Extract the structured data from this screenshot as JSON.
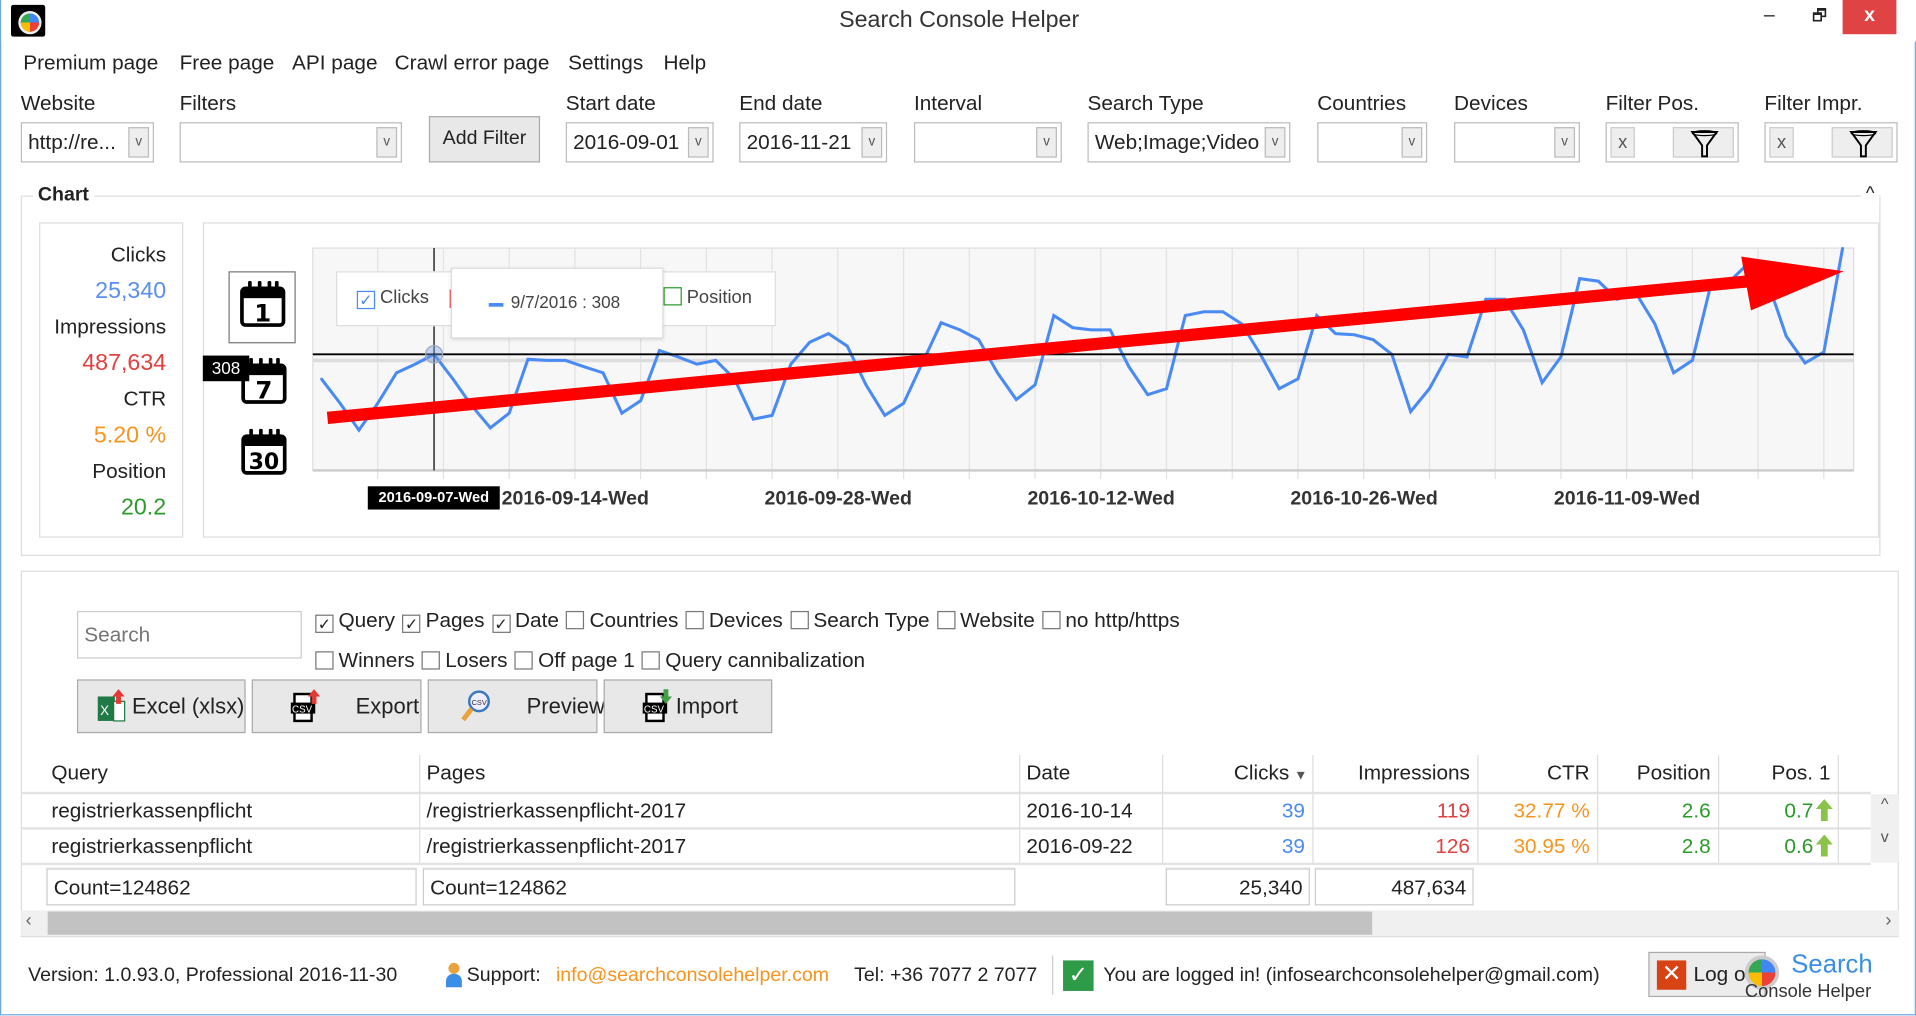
{
  "window": {
    "title": "Search Console Helper",
    "minimize": "–",
    "restore": "🗗",
    "close": "x"
  },
  "menu": [
    "Premium page",
    "Free page",
    "API page",
    "Crawl error page",
    "Settings",
    "Help"
  ],
  "toolbar": {
    "website": {
      "label": "Website",
      "value": "http://re..."
    },
    "filters": {
      "label": "Filters",
      "value": ""
    },
    "add_filter": "Add Filter",
    "start_date": {
      "label": "Start date",
      "value": "2016-09-01"
    },
    "end_date": {
      "label": "End date",
      "value": "2016-11-21"
    },
    "interval": {
      "label": "Interval",
      "value": ""
    },
    "search_type": {
      "label": "Search Type",
      "value": "Web;Image;Video"
    },
    "countries": {
      "label": "Countries",
      "value": ""
    },
    "devices": {
      "label": "Devices",
      "value": ""
    },
    "filter_pos": {
      "label": "Filter Pos.",
      "clear": "x"
    },
    "filter_impr": {
      "label": "Filter Impr.",
      "clear": "x"
    }
  },
  "chart_section": {
    "title": "Chart",
    "collapse": "^"
  },
  "stats": {
    "clicks_label": "Clicks",
    "clicks": "25,340",
    "impressions_label": "Impressions",
    "impressions": "487,634",
    "ctr_label": "CTR",
    "ctr": "5.20 %",
    "position_label": "Position",
    "position": "20.2"
  },
  "colors": {
    "clicks": "#4a8af4",
    "impressions": "#e04040",
    "ctr": "#f7941d",
    "position": "#2a9a2a",
    "arrow": "#ff0000",
    "close": "#e04343"
  },
  "calendar_icons": [
    "1",
    "7",
    "30"
  ],
  "legend": {
    "clicks": "Clicks",
    "position": "Position"
  },
  "tooltip": {
    "text": "9/7/2016 : 308",
    "y_marker": "308",
    "x_marker": "2016-09-07-Wed"
  },
  "chart_data": {
    "type": "line",
    "series": [
      {
        "name": "Clicks",
        "color": "#4a8af4",
        "values": [
          243,
          178,
          107,
          178,
          259,
          282,
          308,
          243,
          172,
          113,
          152,
          295,
          292,
          292,
          275,
          259,
          152,
          185,
          318,
          301,
          282,
          292,
          243,
          136,
          146,
          282,
          340,
          363,
          330,
          227,
          146,
          178,
          285,
          392,
          373,
          347,
          259,
          188,
          227,
          411,
          379,
          373,
          373,
          275,
          201,
          217,
          411,
          421,
          421,
          389,
          308,
          217,
          243,
          411,
          363,
          360,
          347,
          308,
          156,
          217,
          308,
          301,
          454,
          454,
          373,
          233,
          301,
          509,
          502,
          454,
          470,
          389,
          259,
          292,
          496,
          502,
          551,
          502,
          356,
          285,
          314,
          590
        ]
      }
    ],
    "x_range": [
      "2016-09-01",
      "2016-11-21"
    ],
    "x_tick_labels": [
      "2016-09-14-Wed",
      "2016-09-28-Wed",
      "2016-10-12-Wed",
      "2016-10-26-Wed",
      "2016-11-09-Wed"
    ],
    "highlight": {
      "x": "2016-09-07",
      "y": 308
    },
    "trend_arrow": true,
    "grid": true
  },
  "table_controls": {
    "search_placeholder": "Search",
    "options_row1": [
      {
        "label": "Query",
        "checked": true
      },
      {
        "label": "Pages",
        "checked": true
      },
      {
        "label": "Date",
        "checked": true
      },
      {
        "label": "Countries",
        "checked": false
      },
      {
        "label": "Devices",
        "checked": false
      },
      {
        "label": "Search Type",
        "checked": false
      },
      {
        "label": "Website",
        "checked": false
      },
      {
        "label": "no http/https",
        "checked": false
      }
    ],
    "options_row2": [
      {
        "label": "Winners",
        "checked": false
      },
      {
        "label": "Losers",
        "checked": false
      },
      {
        "label": "Off page 1",
        "checked": false
      },
      {
        "label": "Query cannibalization",
        "checked": false
      }
    ],
    "buttons": {
      "excel": "Excel (xlsx)",
      "export": "Export",
      "preview": "Preview",
      "import": "Import"
    }
  },
  "table": {
    "headers": [
      "Query",
      "Pages",
      "Date",
      "Clicks",
      "Impressions",
      "CTR",
      "Position",
      "Pos. 1"
    ],
    "sort_indicator": "▼",
    "rows": [
      [
        "registrierkassenpflicht",
        "/registrierkassenpflicht-2017",
        "2016-10-14",
        "39",
        "119",
        "32.77 %",
        "2.6",
        "0.7"
      ],
      [
        "registrierkassenpflicht",
        "/registrierkassenpflicht-2017",
        "2016-09-22",
        "39",
        "126",
        "30.95 %",
        "2.8",
        "0.6"
      ]
    ],
    "footer": {
      "query_count": "Count=124862",
      "pages_count": "Count=124862",
      "clicks_total": "25,340",
      "impressions_total": "487,634"
    }
  },
  "status": {
    "version": "Version:  1.0.93.0,  Professional 2016-11-30",
    "support_label": "Support:",
    "support_email": "info@searchconsolehelper.com",
    "tel": "Tel: +36 7077 2 7077",
    "logged_in": "You are logged in! (infosearchconsolehelper@gmail.com)",
    "logout": "Log out",
    "logo_line1": "Search",
    "logo_line2": "Console Helper"
  }
}
